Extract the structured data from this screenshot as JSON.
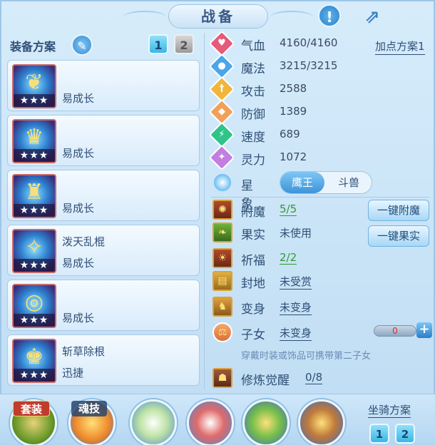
{
  "title": "战备",
  "icons": {
    "alert": "exclamation-icon",
    "share": "share-arrow-icon"
  },
  "equip": {
    "title": "装备方案",
    "schemes": [
      "1",
      "2"
    ],
    "items": [
      {
        "name": "",
        "effect": "易成长",
        "stars": "★★★"
      },
      {
        "name": "",
        "effect": "易成长",
        "stars": "★★★"
      },
      {
        "name": "",
        "effect": "易成长",
        "stars": "★★★"
      },
      {
        "name": "泼天乱棍",
        "effect": "易成长",
        "stars": "★★★"
      },
      {
        "name": "",
        "effect": "易成长",
        "stars": "★★★"
      },
      {
        "name": "斩草除根",
        "effect": "迅捷",
        "stars": "★★★"
      }
    ]
  },
  "stats": {
    "addpoint": "加点方案1",
    "rows": [
      {
        "label": "气血",
        "value": "4160/4160",
        "color": "#e65a7a",
        "glyph": "♥"
      },
      {
        "label": "魔法",
        "value": "3215/3215",
        "color": "#4aa6ea",
        "glyph": "●"
      },
      {
        "label": "攻击",
        "value": "2588",
        "color": "#f0b53a",
        "glyph": "†"
      },
      {
        "label": "防御",
        "value": "1389",
        "color": "#f0a05a",
        "glyph": "◆"
      },
      {
        "label": "速度",
        "value": "689",
        "color": "#2fc48a",
        "glyph": "⚡"
      },
      {
        "label": "灵力",
        "value": "1072",
        "color": "#c27ee0",
        "glyph": "✦"
      }
    ]
  },
  "star": {
    "label": "星象",
    "opt_a": "鹰王",
    "opt_b": "斗兽"
  },
  "features": [
    {
      "label": "附魔",
      "value": "5/5",
      "style": "green"
    },
    {
      "label": "果实",
      "value": "未使用",
      "style": "plain"
    },
    {
      "label": "祈福",
      "value": "2/2",
      "style": "green"
    },
    {
      "label": "封地",
      "value": "未受赏",
      "style": "ul"
    },
    {
      "label": "变身",
      "value": "未变身",
      "style": "ul"
    },
    {
      "label": "子女",
      "value": "未变身",
      "style": "ul"
    }
  ],
  "buttons": {
    "enchant": "一键附魔",
    "fruit": "一键果实"
  },
  "child_bar_value": "0",
  "hint": "穿戴时装或饰品可携带第二子女",
  "awaken": {
    "label": "修炼觉醒",
    "value": "0/8"
  },
  "bottom": {
    "suit": "套装",
    "soul": "魂技",
    "mount_title": "坐骑方案",
    "mount_schemes": [
      "1",
      "2"
    ]
  }
}
